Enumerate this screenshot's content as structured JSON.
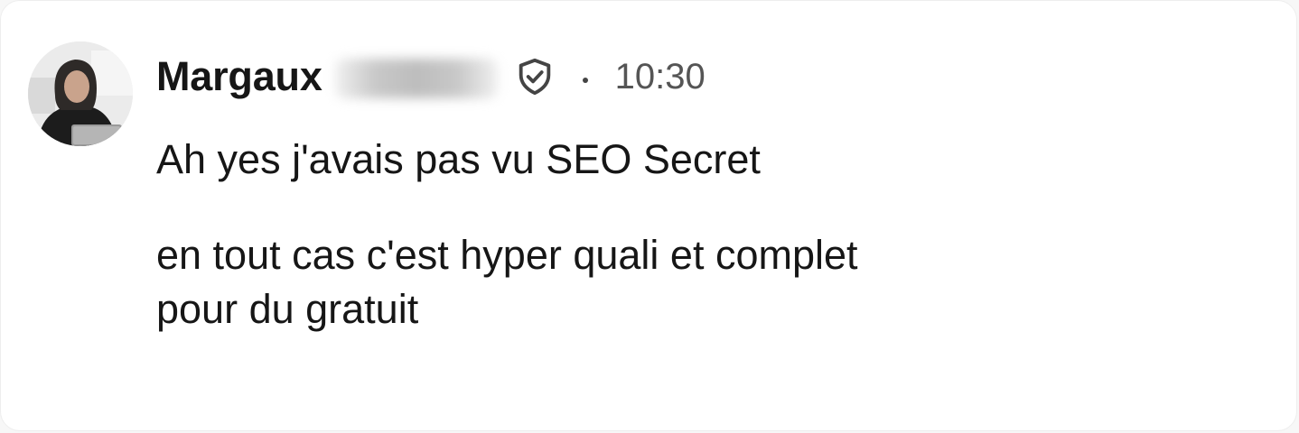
{
  "message": {
    "author": {
      "first_name": "Margaux",
      "last_name_hidden": true,
      "verified_icon": "shield-check-icon",
      "avatar_icon": "avatar-photo"
    },
    "time": "10:30",
    "lines": [
      "Ah yes j'avais pas vu SEO Secret",
      "en tout cas c'est hyper quali et complet",
      "pour du gratuit"
    ]
  },
  "colors": {
    "text": "#161616",
    "muted": "#555555",
    "background": "#ffffff"
  }
}
